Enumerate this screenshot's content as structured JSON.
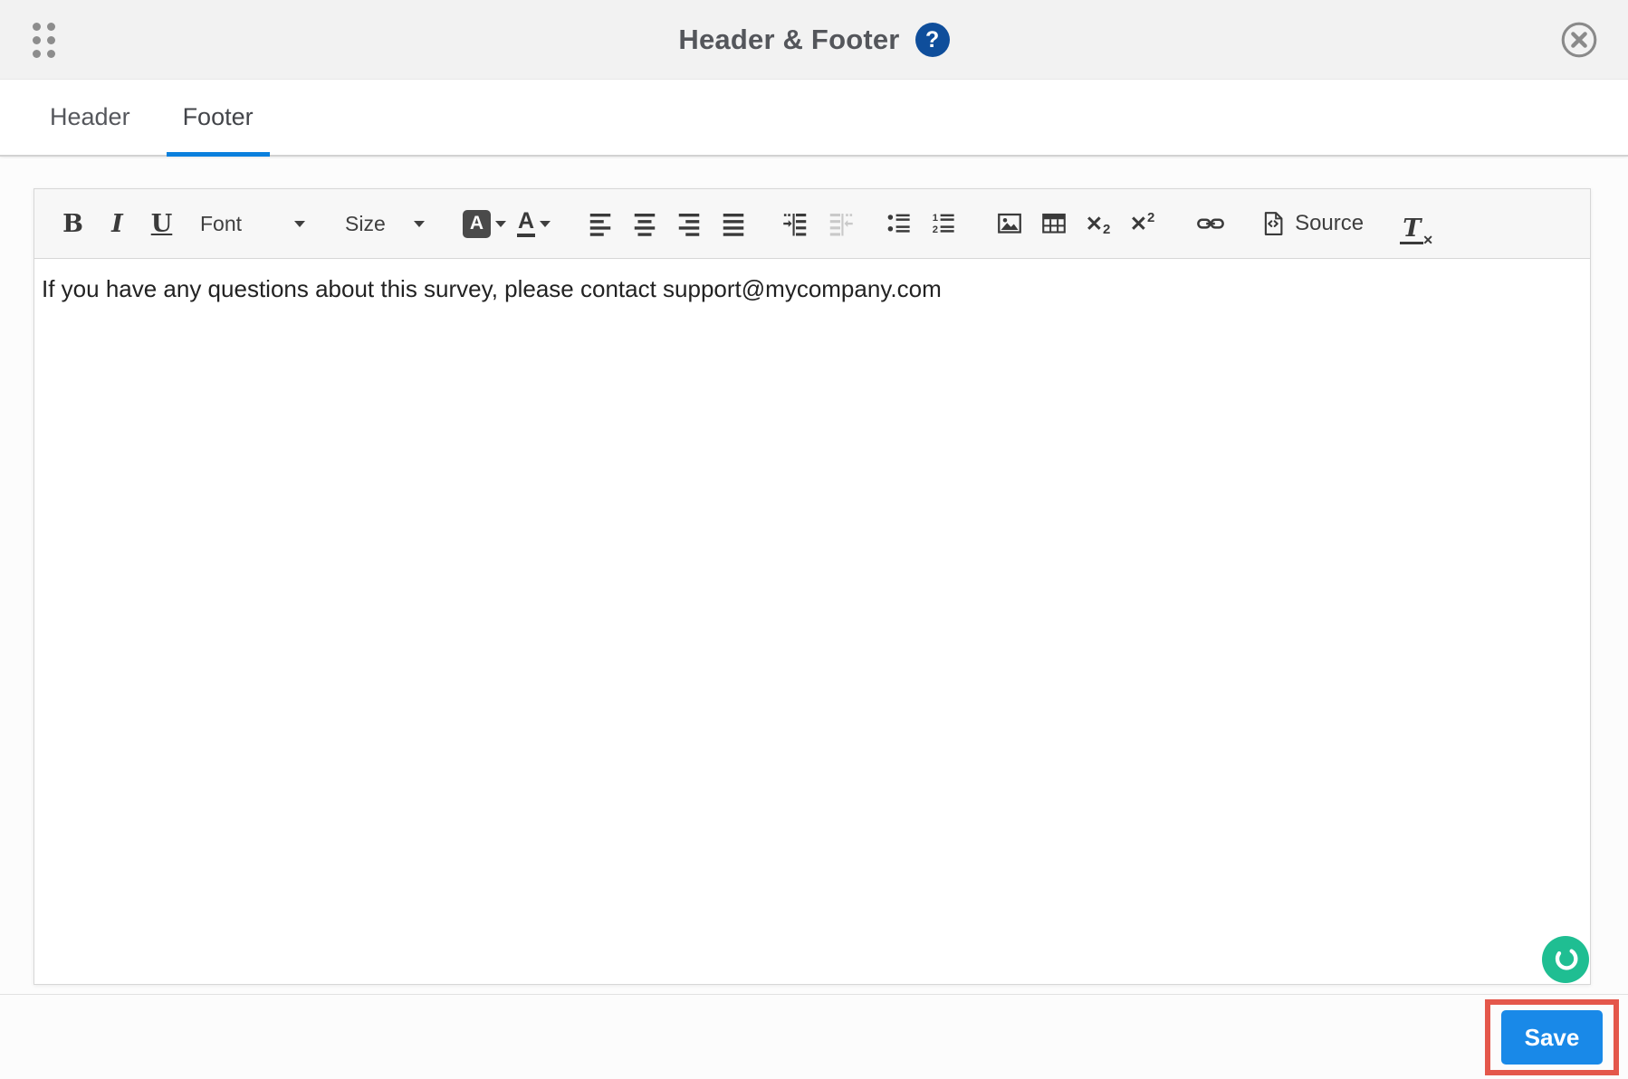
{
  "modal": {
    "title": "Header & Footer",
    "help_glyph": "?"
  },
  "tabs": {
    "header": "Header",
    "footer": "Footer"
  },
  "toolbar": {
    "bold": "B",
    "italic": "I",
    "underline": "U",
    "font": "Font",
    "size": "Size",
    "text_color_letter": "A",
    "bg_color_letter": "A",
    "numbered_1": "1",
    "numbered_2": "2",
    "sub_base": "✕",
    "sub_mark": "2",
    "sup_base": "✕",
    "sup_mark": "2",
    "source": "Source",
    "remove_format_letter": "T",
    "remove_format_mark": "✕"
  },
  "editor": {
    "content": "If you have any questions about this survey, please contact support@mycompany.com"
  },
  "footer": {
    "save": "Save"
  },
  "colors": {
    "topbar_bg": "#f2f2f2",
    "tab_underline": "#0b80dd",
    "help_icon_bg": "#0f4e9b",
    "save_button_bg": "#1989e8",
    "annotation_border": "#e4574b",
    "beacon_bg": "#1fbe92",
    "toolbar_icon": "#3a3a3a",
    "disabled_icon": "#c9c9c9"
  }
}
